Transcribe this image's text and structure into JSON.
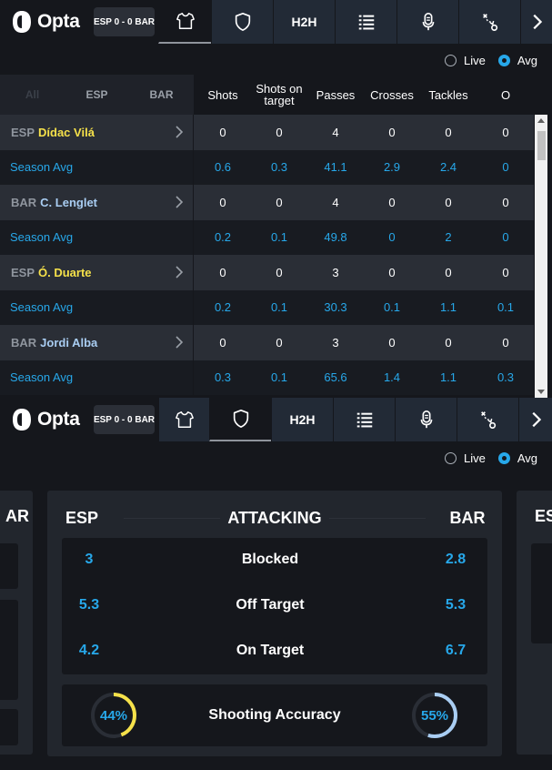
{
  "app": {
    "brand": "Opta",
    "score": "ESP 0 - 0 BAR"
  },
  "nav": {
    "h2h": "H2H"
  },
  "toggles": {
    "live": "Live",
    "avg": "Avg"
  },
  "filters": [
    "All",
    "ESP",
    "BAR"
  ],
  "columns": [
    "Shots",
    "Shots on target",
    "Passes",
    "Crosses",
    "Tackles",
    "O"
  ],
  "players": [
    {
      "team": "ESP",
      "name": "Dídac Vilá",
      "name_color": "#f5e14a",
      "stats": [
        "0",
        "0",
        "4",
        "0",
        "0",
        "0"
      ],
      "avg_label": "Season Avg",
      "avg": [
        "0.6",
        "0.3",
        "41.1",
        "2.9",
        "2.4",
        "0"
      ]
    },
    {
      "team": "BAR",
      "name": "C. Lenglet",
      "name_color": "#a9cdf2",
      "stats": [
        "0",
        "0",
        "4",
        "0",
        "0",
        "0"
      ],
      "avg_label": "Season Avg",
      "avg": [
        "0.2",
        "0.1",
        "49.8",
        "0",
        "2",
        "0"
      ]
    },
    {
      "team": "ESP",
      "name": "Ó. Duarte",
      "name_color": "#f5e14a",
      "stats": [
        "0",
        "0",
        "3",
        "0",
        "0",
        "0"
      ],
      "avg_label": "Season Avg",
      "avg": [
        "0.2",
        "0.1",
        "30.3",
        "0.1",
        "1.1",
        "0.1"
      ]
    },
    {
      "team": "BAR",
      "name": "Jordi Alba",
      "name_color": "#a9cdf2",
      "stats": [
        "0",
        "0",
        "3",
        "0",
        "0",
        "0"
      ],
      "avg_label": "Season Avg",
      "avg": [
        "0.3",
        "0.1",
        "65.6",
        "1.4",
        "1.1",
        "0.3"
      ]
    }
  ],
  "attacking": {
    "home": "ESP",
    "title": "ATTACKING",
    "away": "BAR",
    "rows": [
      {
        "label": "Blocked",
        "home": "3",
        "away": "2.8"
      },
      {
        "label": "Off Target",
        "home": "5.3",
        "away": "5.3"
      },
      {
        "label": "On Target",
        "home": "4.2",
        "away": "6.7"
      }
    ],
    "accuracy": {
      "label": "Shooting Accuracy",
      "home": "44%",
      "away": "55%",
      "home_value": 0.44,
      "away_value": 0.55,
      "home_color": "#f5e14a",
      "away_color": "#a9cdf2"
    }
  },
  "side_cards": {
    "left_partial": "AR",
    "right_partial": "ES"
  },
  "colors": {
    "accent": "#27a8ea",
    "esp": "#f5e14a",
    "bar": "#a9cdf2"
  },
  "icons": [
    "opta-logo-icon",
    "shirt-icon",
    "shield-icon",
    "list-icon",
    "microphone-icon",
    "tactics-icon",
    "chevron-right-icon"
  ]
}
